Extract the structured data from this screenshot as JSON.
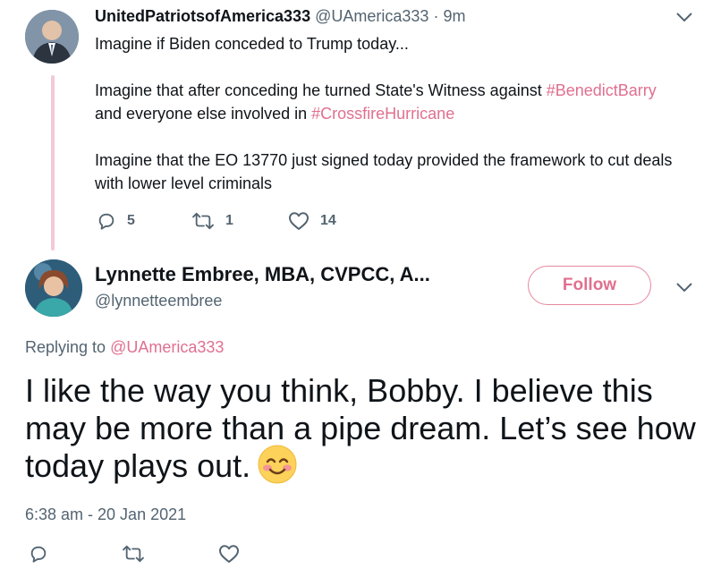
{
  "tweet": {
    "author_name": "UnitedPatriotsofAmerica333",
    "author_handle": "@UAmerica333",
    "separator": "·",
    "time_ago": "9m",
    "lines": {
      "line1": "Imagine if Biden conceded to Trump today...",
      "line2_pre": "Imagine that after conceding he turned State's Witness against ",
      "line2_tag1": "#BenedictBarry",
      "line2_mid": " and everyone else involved in ",
      "line2_tag2": "#CrossfireHurricane",
      "line3": "Imagine that the EO 13770 just signed today provided the framework to cut deals with lower level criminals"
    },
    "reply_count": "5",
    "retweet_count": "1",
    "like_count": "14"
  },
  "reply": {
    "author_name": "Lynnette Embree, MBA, CVPCC, A...",
    "author_handle": "@lynnetteembree",
    "follow_label": "Follow",
    "replying_prefix": "Replying to ",
    "replying_mention": "@UAmerica333",
    "text": "I like the way you think, Bobby. I believe this may be more than a pipe dream. Let’s see how today plays out.",
    "emoji": "smiling-face-with-smiling-eyes",
    "timestamp": "6:38 am - 20 Jan 2021"
  },
  "colors": {
    "accent": "#e0708f",
    "muted": "#536471",
    "thread_line": "#f4c9d6"
  }
}
